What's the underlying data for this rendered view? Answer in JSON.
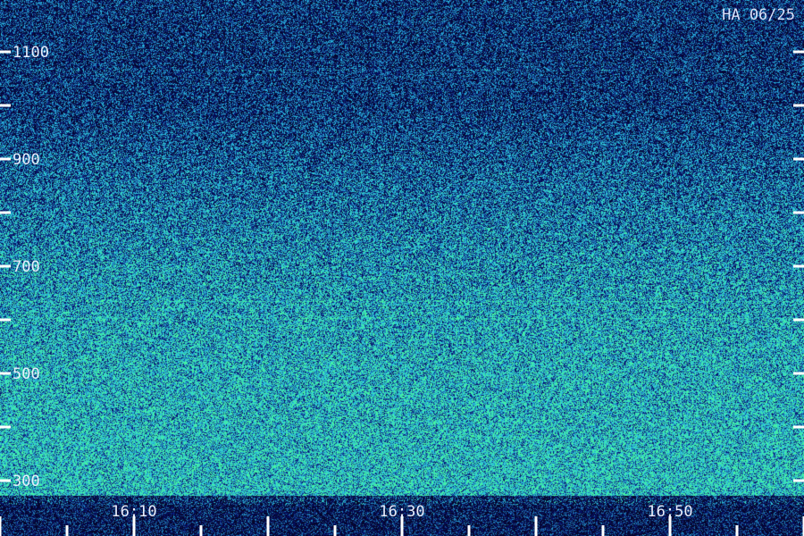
{
  "station_label": "HA 06/25",
  "colors": {
    "background": "#0a0a3a",
    "low": "#10106e",
    "mid": "#2a7adf",
    "high": "#2de8b0",
    "tick": "#ffffff"
  },
  "chart_data": {
    "type": "heatmap",
    "title": "",
    "xlabel": "",
    "ylabel": "",
    "x_ticks": [
      {
        "value": "16:10",
        "minutes": 10,
        "labeled": true
      },
      {
        "value": "16:30",
        "minutes": 30,
        "labeled": true
      },
      {
        "value": "16:50",
        "minutes": 50,
        "labeled": true
      }
    ],
    "x_range_minutes": [
      0,
      60
    ],
    "x_minor_step_minutes": 5,
    "y_ticks": [
      1100,
      900,
      700,
      500,
      300
    ],
    "y_range": [
      270,
      1190
    ],
    "y_minor_step": 100,
    "intensity_profile": [
      {
        "y": 1100,
        "level": 0.28
      },
      {
        "y": 1000,
        "level": 0.3
      },
      {
        "y": 900,
        "level": 0.42
      },
      {
        "y": 800,
        "level": 0.52
      },
      {
        "y": 700,
        "level": 0.6
      },
      {
        "y": 600,
        "level": 0.66
      },
      {
        "y": 500,
        "level": 0.7
      },
      {
        "y": 400,
        "level": 0.72
      },
      {
        "y": 300,
        "level": 0.74
      }
    ]
  }
}
